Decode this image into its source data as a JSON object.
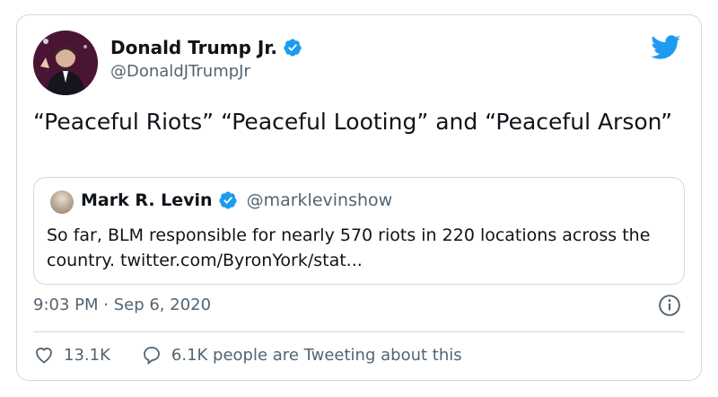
{
  "tweet": {
    "author": {
      "name": "Donald Trump Jr.",
      "handle": "@DonaldJTrumpJr",
      "avatar_icon": "profile-photo",
      "verified_icon": "verified-badge-icon"
    },
    "brand_icon": "twitter-bird-icon",
    "text": "“Peaceful Riots” “Peaceful Looting” and “Peaceful Arson”",
    "quoted": {
      "name": "Mark R. Levin",
      "handle": "@marklevinshow",
      "text": "So far, BLM responsible for nearly 570 riots in 220 locations across the country. twitter.com/ByronYork/stat..."
    },
    "timestamp": "9:03 PM · Sep 6, 2020",
    "info_icon": "info-icon",
    "likes": "13.1K",
    "retweet_summary": "6.1K people are Tweeting about this"
  },
  "colors": {
    "twitter_blue": "#1d9bf0",
    "secondary_text": "#536471",
    "border": "#cfd9de"
  }
}
